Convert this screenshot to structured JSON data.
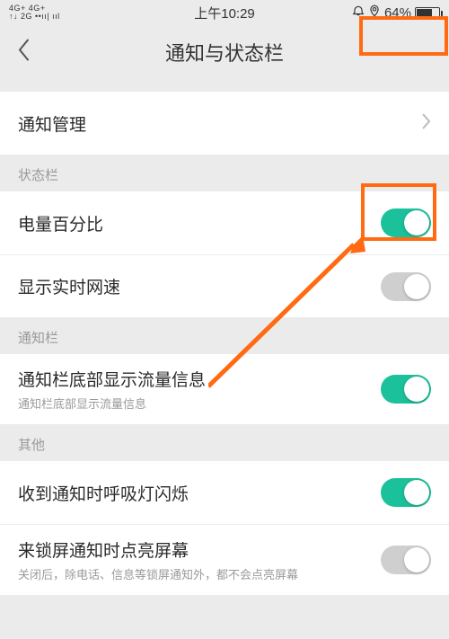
{
  "status": {
    "signal_top": "4G+ 4G+",
    "signal_bottom": "↑↓ 2G ••ıı| ııl",
    "time": "上午10:29",
    "battery_percent": "64%"
  },
  "nav": {
    "title": "通知与状态栏"
  },
  "rows": {
    "notify_mgmt": "通知管理",
    "battery_pct": "电量百分比",
    "net_speed": "显示实时网速",
    "traffic_label": "通知栏底部显示流量信息",
    "traffic_sub": "通知栏底部显示流量信息",
    "led": "收到通知时呼吸灯闪烁",
    "screen_on_label": "来锁屏通知时点亮屏幕",
    "screen_on_sub": "关闭后，除电话、信息等锁屏通知外，都不会点亮屏幕"
  },
  "sections": {
    "status_bar": "状态栏",
    "notify_panel": "通知栏",
    "other": "其他"
  },
  "colors": {
    "accent": "#1bc19b",
    "annot": "#ff6a13"
  },
  "toggles": {
    "battery_pct": true,
    "net_speed": false,
    "traffic": true,
    "led": true,
    "screen_on": false
  }
}
